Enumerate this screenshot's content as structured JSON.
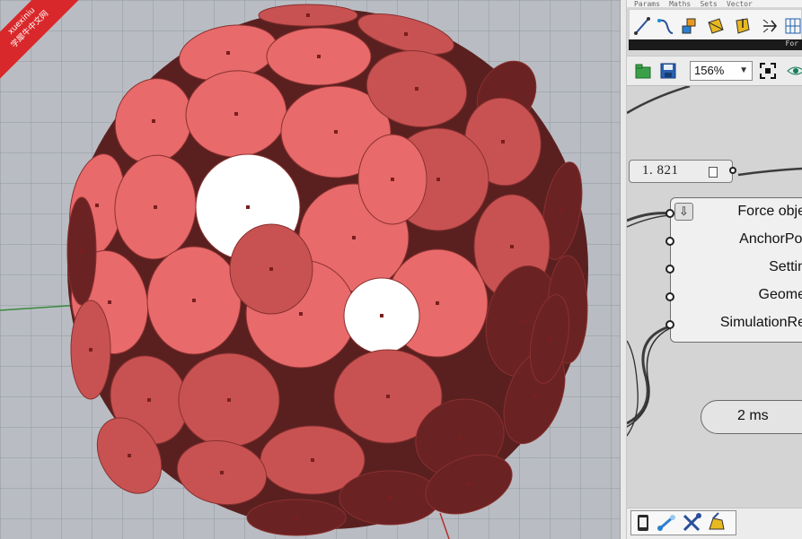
{
  "watermark": {
    "brand": "xuexiniu",
    "site": "学犀牛中文网"
  },
  "grasshopper": {
    "tabs": [
      "Params",
      "Maths",
      "Sets",
      "Vector"
    ],
    "group_label": "For",
    "canvas_toolbar": {
      "zoom": "156%"
    },
    "slider": {
      "value": "1. 821"
    },
    "component": {
      "inputs": [
        "Force obje",
        "AnchorPoi",
        "Settin",
        "Geome",
        "SimulationRe"
      ]
    },
    "timer": {
      "label": "2 ms"
    }
  },
  "colors": {
    "disc_light": "#e86a6a",
    "disc_mid": "#c85252",
    "disc_dark": "#6b2222",
    "disc_white": "#ffffff",
    "viewport_bg": "#b9bdc3"
  },
  "icons": {
    "toolbar": [
      "line-icon",
      "curve-icon",
      "box-icon",
      "surface-icon",
      "arrow-icon",
      "grid-icon"
    ],
    "canvas": [
      "open-file-icon",
      "save-file-icon",
      "zoom-extents-icon",
      "eye-icon"
    ],
    "status": [
      "phone-icon",
      "link-icon",
      "tools-icon",
      "sketch-icon"
    ]
  }
}
